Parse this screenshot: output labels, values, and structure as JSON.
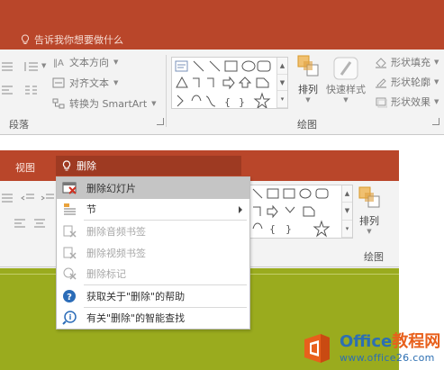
{
  "top": {
    "tellme_text": "告诉我你想要做什么",
    "text_direction_label": "文本方向",
    "align_text_label": "对齐文本",
    "convert_smartart_label": "转换为 SmartArt",
    "group_paragraph_label": "段落",
    "arrange_label": "排列",
    "quick_styles_label": "快速样式",
    "shape_fill_label": "形状填充",
    "shape_outline_label": "形状轮廓",
    "shape_effects_label": "形状效果",
    "group_drawing_label": "绘图"
  },
  "bottom": {
    "tab_view_label": "视图",
    "search_value": "删除",
    "arrange_label": "排列",
    "group_drawing_label": "绘图",
    "menu": {
      "delete_slide": "删除幻灯片",
      "section": "节",
      "delete_audio_bookmark": "删除音频书签",
      "delete_video_bookmark": "删除视频书签",
      "delete_markup": "删除标记",
      "help": "获取关于\"删除\"的帮助",
      "smart_lookup": "有关\"删除\"的智能查找"
    }
  },
  "watermark": {
    "brand_office": "Office",
    "brand_suffix": "教程网",
    "url": "www.office26.com"
  },
  "colors": {
    "title_bar": "#b9462a",
    "ribbon_bg": "#f3f3f3",
    "slide_green": "#9aab1e",
    "menu_highlight": "#c5c5c5",
    "help_blue": "#2b6cb8",
    "watermark_blue": "#2d6fb2",
    "watermark_orange": "#e8601c"
  },
  "icons": [
    "lightbulb-icon",
    "text-direction-icon",
    "align-text-icon",
    "smartart-icon",
    "shapes-gallery",
    "arrange-icon",
    "quick-styles-icon",
    "shape-fill-icon",
    "shape-outline-icon",
    "shape-effects-icon",
    "delete-slide-icon",
    "section-icon",
    "delete-bookmark-icon",
    "delete-markup-icon",
    "help-icon",
    "smart-lookup-icon",
    "office-logo-icon"
  ]
}
